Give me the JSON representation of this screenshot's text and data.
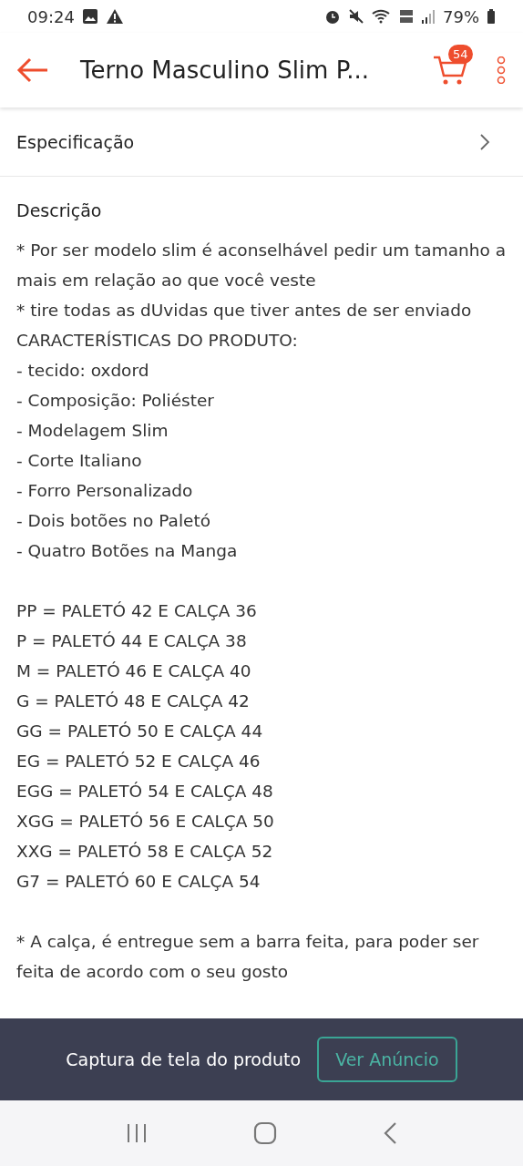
{
  "status_bar": {
    "time": "09:24",
    "battery": "79%"
  },
  "header": {
    "title": "Terno Masculino Slim P...",
    "cart_count": "54"
  },
  "specification": {
    "label": "Especificação"
  },
  "description": {
    "title": "Descrição",
    "paragraphs": [
      [
        "* Por ser modelo slim é aconselhável pedir um tamanho a mais em relação ao que você veste",
        "* tire todas as dUvidas que tiver antes de ser enviado",
        "CARACTERÍSTICAS DO PRODUTO:",
        "- tecido: oxdord",
        "- Composição: Poliéster",
        "- Modelagem Slim",
        "- Corte Italiano",
        "- Forro Personalizado",
        "- Dois botões no Paletó",
        "- Quatro Botões na Manga"
      ],
      [
        "PP = PALETÓ 42 E CALÇA 36",
        "P = PALETÓ 44 E CALÇA 38",
        "M = PALETÓ 46 E CALÇA 40",
        "G = PALETÓ 48 E CALÇA 42",
        "GG = PALETÓ 50 E CALÇA 44",
        "EG = PALETÓ 52 E CALÇA 46",
        "EGG = PALETÓ 54 E CALÇA 48",
        "XGG = PALETÓ 56 E CALÇA 50",
        "XXG = PALETÓ 58 E CALÇA 52",
        "G7 = PALETÓ 60 E CALÇA 54"
      ],
      [
        "* A calça, é entregue sem a barra feita, para poder ser feita de acordo com o seu gosto"
      ]
    ]
  },
  "screenshot_bar": {
    "text": "Captura de tela do produto",
    "button": "Ver Anúncio"
  }
}
